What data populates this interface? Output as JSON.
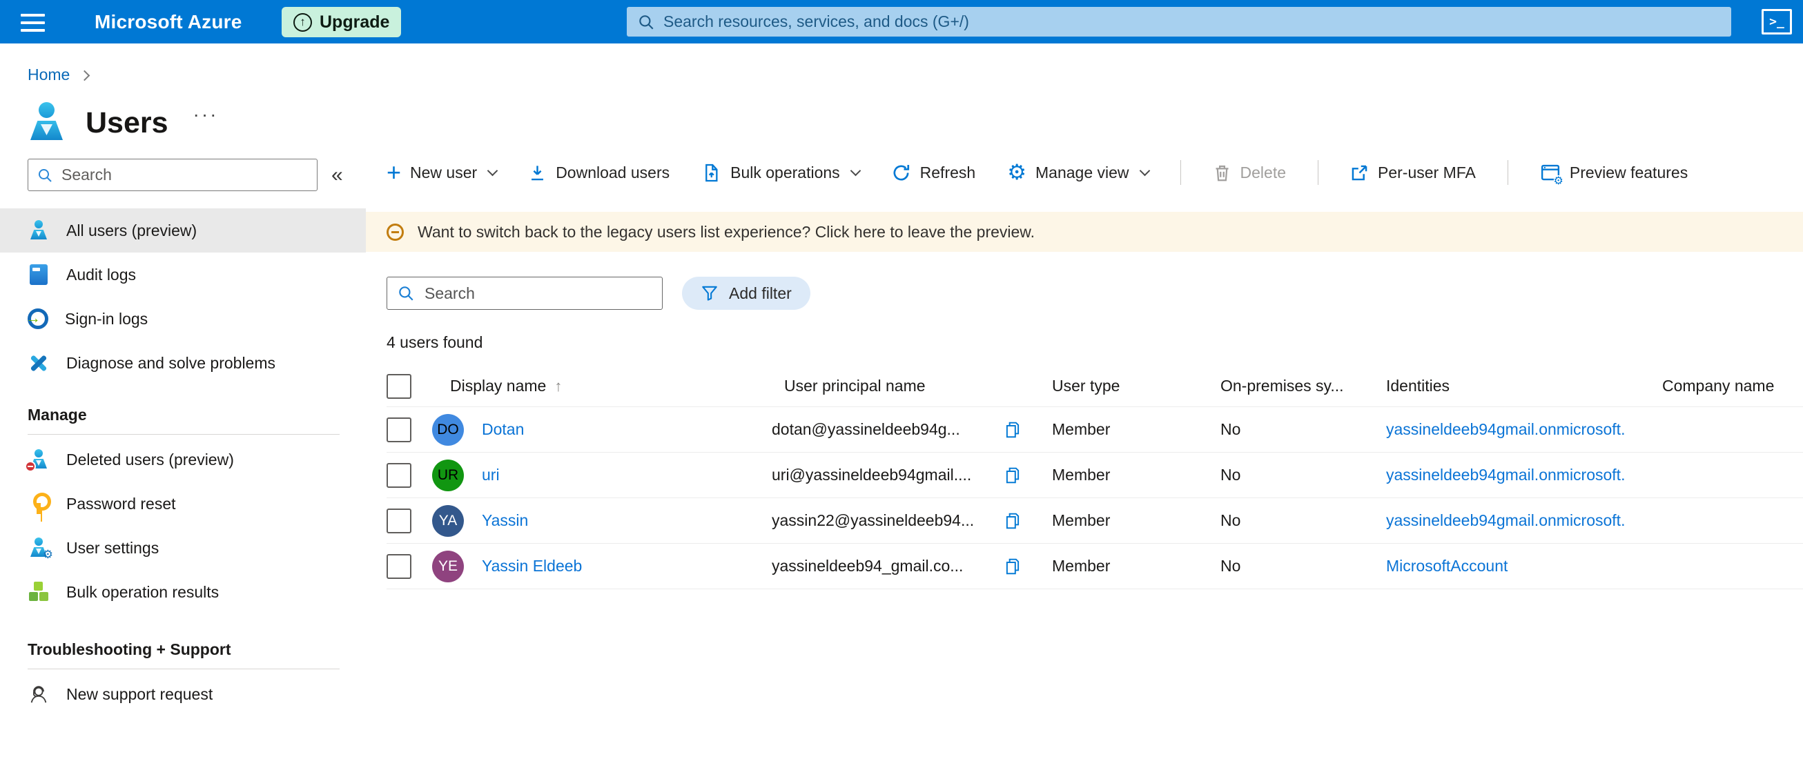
{
  "colors": {
    "accent": "#0078d4",
    "topbar_bg": "#0078d4",
    "upgrade_bg": "#c9f1dd",
    "banner_bg": "#fdf6e7",
    "banner_icon": "#c27d10",
    "selected_nav_bg": "#e9e9e9",
    "link": "#0b74d6"
  },
  "topbar": {
    "brand": "Microsoft Azure",
    "upgrade_label": "Upgrade",
    "upgrade_glyph": "↑",
    "search_placeholder": "Search resources, services, and docs (G+/)",
    "cloud_shell_glyph": ">_"
  },
  "breadcrumb": {
    "home": "Home"
  },
  "page": {
    "title": "Users",
    "more_glyph": "···"
  },
  "sidebar": {
    "search_placeholder": "Search",
    "collapse_glyph": "«",
    "items": [
      {
        "label": "All users (preview)",
        "selected": true
      },
      {
        "label": "Audit logs",
        "selected": false
      },
      {
        "label": "Sign-in logs",
        "selected": false
      },
      {
        "label": "Diagnose and solve problems",
        "selected": false
      }
    ],
    "signin_arrow_glyph": "→",
    "sections": [
      {
        "header": "Manage",
        "items": [
          "Deleted users (preview)",
          "Password reset",
          "User settings",
          "Bulk operation results"
        ]
      },
      {
        "header": "Troubleshooting + Support",
        "items": [
          "New support request"
        ]
      }
    ]
  },
  "toolbar": {
    "new_user": "New user",
    "download_users": "Download users",
    "bulk_operations": "Bulk operations",
    "refresh": "Refresh",
    "manage_view": "Manage view",
    "delete": "Delete",
    "per_user_mfa": "Per-user MFA",
    "preview_features": "Preview features",
    "gear_glyph": "⚙"
  },
  "banner": {
    "message": "Want to switch back to the legacy users list experience? Click here to leave the preview."
  },
  "filters": {
    "search_placeholder": "Search",
    "add_filter_label": "Add filter"
  },
  "results": {
    "count_text": "4 users found"
  },
  "table": {
    "columns": [
      "Display name",
      "User principal name",
      "User type",
      "On-premises sy...",
      "Identities",
      "Company name"
    ],
    "sort_glyph": "↑",
    "rows": [
      {
        "initials": "DO",
        "avatar_bg": "#4089e0",
        "avatar_fg": "#000000",
        "name": "Dotan",
        "upn": "dotan@yassineldeeb94g...",
        "user_type": "Member",
        "on_premises": "No",
        "identities": "yassineldeeb94gmail.onmicrosoft.",
        "company": ""
      },
      {
        "initials": "UR",
        "avatar_bg": "#119611",
        "avatar_fg": "#000000",
        "name": "uri",
        "upn": "uri@yassineldeeb94gmail....",
        "user_type": "Member",
        "on_premises": "No",
        "identities": "yassineldeeb94gmail.onmicrosoft.",
        "company": ""
      },
      {
        "initials": "YA",
        "avatar_bg": "#33588c",
        "avatar_fg": "#ffffff",
        "name": "Yassin",
        "upn": "yassin22@yassineldeeb94...",
        "user_type": "Member",
        "on_premises": "No",
        "identities": "yassineldeeb94gmail.onmicrosoft.",
        "company": ""
      },
      {
        "initials": "YE",
        "avatar_bg": "#8f437f",
        "avatar_fg": "#ffffff",
        "name": "Yassin Eldeeb",
        "upn": "yassineldeeb94_gmail.co...",
        "user_type": "Member",
        "on_premises": "No",
        "identities": "MicrosoftAccount",
        "company": ""
      }
    ]
  }
}
